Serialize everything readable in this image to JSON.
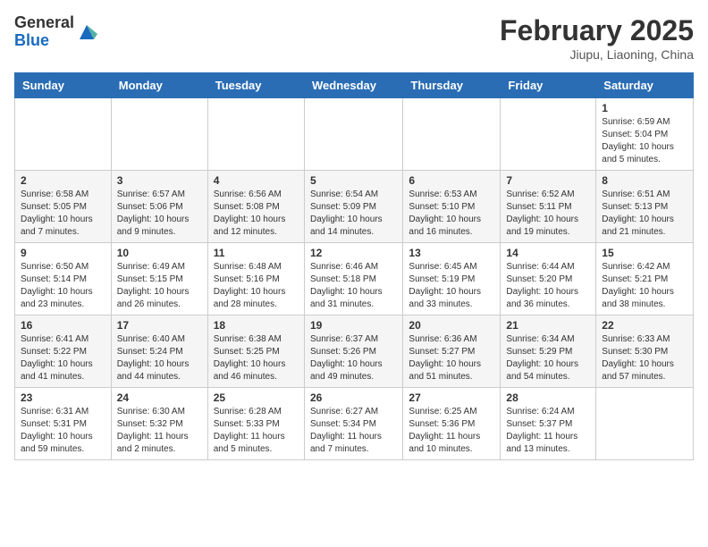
{
  "header": {
    "logo_general": "General",
    "logo_blue": "Blue",
    "month_title": "February 2025",
    "location": "Jiupu, Liaoning, China"
  },
  "weekdays": [
    "Sunday",
    "Monday",
    "Tuesday",
    "Wednesday",
    "Thursday",
    "Friday",
    "Saturday"
  ],
  "weeks": [
    [
      {
        "num": "",
        "info": ""
      },
      {
        "num": "",
        "info": ""
      },
      {
        "num": "",
        "info": ""
      },
      {
        "num": "",
        "info": ""
      },
      {
        "num": "",
        "info": ""
      },
      {
        "num": "",
        "info": ""
      },
      {
        "num": "1",
        "info": "Sunrise: 6:59 AM\nSunset: 5:04 PM\nDaylight: 10 hours and 5 minutes."
      }
    ],
    [
      {
        "num": "2",
        "info": "Sunrise: 6:58 AM\nSunset: 5:05 PM\nDaylight: 10 hours and 7 minutes."
      },
      {
        "num": "3",
        "info": "Sunrise: 6:57 AM\nSunset: 5:06 PM\nDaylight: 10 hours and 9 minutes."
      },
      {
        "num": "4",
        "info": "Sunrise: 6:56 AM\nSunset: 5:08 PM\nDaylight: 10 hours and 12 minutes."
      },
      {
        "num": "5",
        "info": "Sunrise: 6:54 AM\nSunset: 5:09 PM\nDaylight: 10 hours and 14 minutes."
      },
      {
        "num": "6",
        "info": "Sunrise: 6:53 AM\nSunset: 5:10 PM\nDaylight: 10 hours and 16 minutes."
      },
      {
        "num": "7",
        "info": "Sunrise: 6:52 AM\nSunset: 5:11 PM\nDaylight: 10 hours and 19 minutes."
      },
      {
        "num": "8",
        "info": "Sunrise: 6:51 AM\nSunset: 5:13 PM\nDaylight: 10 hours and 21 minutes."
      }
    ],
    [
      {
        "num": "9",
        "info": "Sunrise: 6:50 AM\nSunset: 5:14 PM\nDaylight: 10 hours and 23 minutes."
      },
      {
        "num": "10",
        "info": "Sunrise: 6:49 AM\nSunset: 5:15 PM\nDaylight: 10 hours and 26 minutes."
      },
      {
        "num": "11",
        "info": "Sunrise: 6:48 AM\nSunset: 5:16 PM\nDaylight: 10 hours and 28 minutes."
      },
      {
        "num": "12",
        "info": "Sunrise: 6:46 AM\nSunset: 5:18 PM\nDaylight: 10 hours and 31 minutes."
      },
      {
        "num": "13",
        "info": "Sunrise: 6:45 AM\nSunset: 5:19 PM\nDaylight: 10 hours and 33 minutes."
      },
      {
        "num": "14",
        "info": "Sunrise: 6:44 AM\nSunset: 5:20 PM\nDaylight: 10 hours and 36 minutes."
      },
      {
        "num": "15",
        "info": "Sunrise: 6:42 AM\nSunset: 5:21 PM\nDaylight: 10 hours and 38 minutes."
      }
    ],
    [
      {
        "num": "16",
        "info": "Sunrise: 6:41 AM\nSunset: 5:22 PM\nDaylight: 10 hours and 41 minutes."
      },
      {
        "num": "17",
        "info": "Sunrise: 6:40 AM\nSunset: 5:24 PM\nDaylight: 10 hours and 44 minutes."
      },
      {
        "num": "18",
        "info": "Sunrise: 6:38 AM\nSunset: 5:25 PM\nDaylight: 10 hours and 46 minutes."
      },
      {
        "num": "19",
        "info": "Sunrise: 6:37 AM\nSunset: 5:26 PM\nDaylight: 10 hours and 49 minutes."
      },
      {
        "num": "20",
        "info": "Sunrise: 6:36 AM\nSunset: 5:27 PM\nDaylight: 10 hours and 51 minutes."
      },
      {
        "num": "21",
        "info": "Sunrise: 6:34 AM\nSunset: 5:29 PM\nDaylight: 10 hours and 54 minutes."
      },
      {
        "num": "22",
        "info": "Sunrise: 6:33 AM\nSunset: 5:30 PM\nDaylight: 10 hours and 57 minutes."
      }
    ],
    [
      {
        "num": "23",
        "info": "Sunrise: 6:31 AM\nSunset: 5:31 PM\nDaylight: 10 hours and 59 minutes."
      },
      {
        "num": "24",
        "info": "Sunrise: 6:30 AM\nSunset: 5:32 PM\nDaylight: 11 hours and 2 minutes."
      },
      {
        "num": "25",
        "info": "Sunrise: 6:28 AM\nSunset: 5:33 PM\nDaylight: 11 hours and 5 minutes."
      },
      {
        "num": "26",
        "info": "Sunrise: 6:27 AM\nSunset: 5:34 PM\nDaylight: 11 hours and 7 minutes."
      },
      {
        "num": "27",
        "info": "Sunrise: 6:25 AM\nSunset: 5:36 PM\nDaylight: 11 hours and 10 minutes."
      },
      {
        "num": "28",
        "info": "Sunrise: 6:24 AM\nSunset: 5:37 PM\nDaylight: 11 hours and 13 minutes."
      },
      {
        "num": "",
        "info": ""
      }
    ]
  ]
}
